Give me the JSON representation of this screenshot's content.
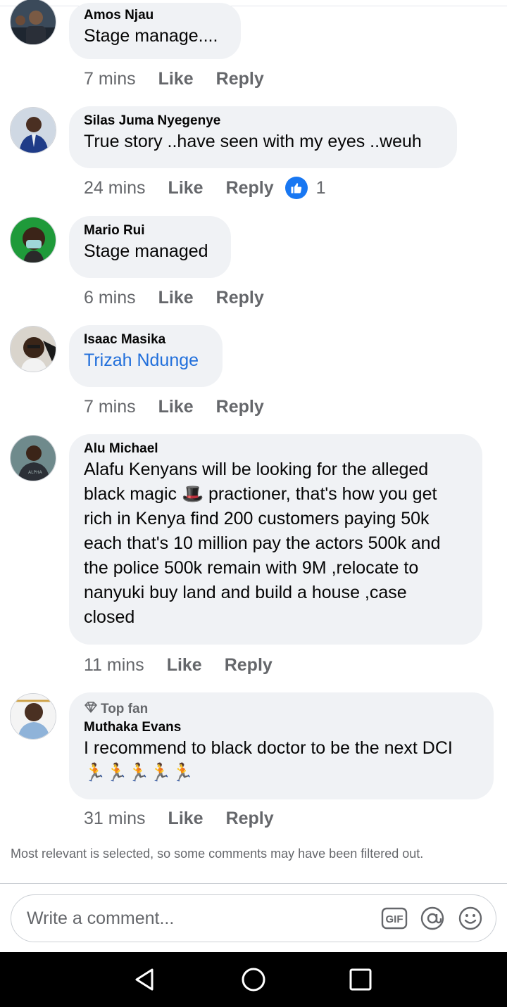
{
  "comments": [
    {
      "author": "Amos Njau",
      "text": "Stage manage....",
      "time": "7 mins",
      "like": "Like",
      "reply": "Reply"
    },
    {
      "author": "Silas Juma Nyegenye",
      "text": "True story ..have seen with my eyes ..weuh",
      "time": "24 mins",
      "like": "Like",
      "reply": "Reply",
      "reaction_count": "1"
    },
    {
      "author": "Mario Rui",
      "text": "Stage managed",
      "time": "6 mins",
      "like": "Like",
      "reply": "Reply"
    },
    {
      "author": "Isaac Masika",
      "text": "Trizah Ndunge",
      "time": "7 mins",
      "like": "Like",
      "reply": "Reply"
    },
    {
      "author": "Alu Michael",
      "text_lines": [
        "Alafu Kenyans will be looking for the alleged",
        "black magic 🎩 practioner, that's how you get",
        "rich in Kenya find 200 customers paying 50k",
        "each that's 10 million pay the actors 500k and",
        "the police 500k remain with 9M ,relocate to",
        "nanyuki  buy land and build a house ,case",
        "closed"
      ],
      "time": "11 mins",
      "like": "Like",
      "reply": "Reply"
    },
    {
      "badge": "Top fan",
      "author": "Muthaka Evans",
      "text": "I recommend to black doctor to be the next DCI",
      "emojis": "🏃🏃🏃🏃🏃",
      "time": "31 mins",
      "like": "Like",
      "reply": "Reply"
    }
  ],
  "filter_note": "Most relevant is selected, so some comments may have been filtered out.",
  "composer": {
    "placeholder": "Write a comment...",
    "gif_label": "GIF"
  },
  "icons": {
    "like_reaction": "thumbs-up-icon",
    "mention": "at-sign-icon",
    "emoji": "smiley-icon",
    "back": "back-triangle-icon",
    "home": "home-circle-icon",
    "recents": "recents-square-icon"
  },
  "colors": {
    "link": "#216fdb",
    "reaction_blue": "#1877f2",
    "bubble": "#f0f2f5",
    "meta": "#65676b"
  }
}
